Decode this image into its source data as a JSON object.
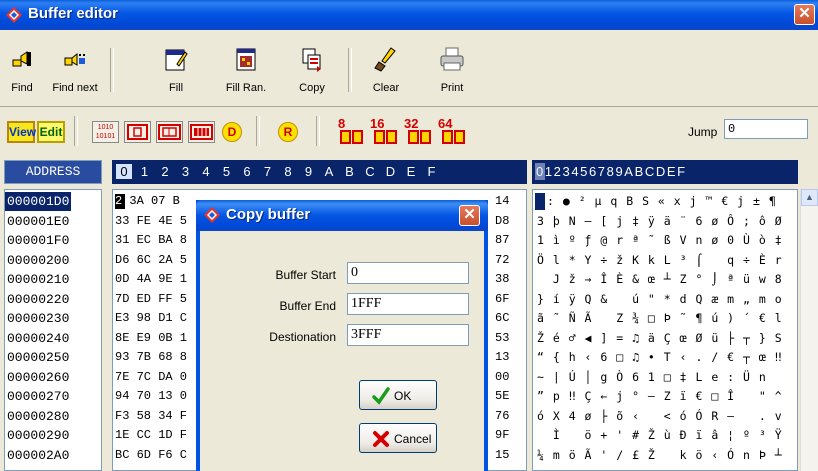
{
  "window": {
    "title": "Buffer editor",
    "close": "✕"
  },
  "toolbar": {
    "buttons": [
      {
        "label": "Find",
        "icon": "find-icon"
      },
      {
        "label": "Find next",
        "icon": "find-next-icon"
      },
      {
        "label": "Fill",
        "icon": "fill-icon"
      },
      {
        "label": "Fill Ran.",
        "icon": "fill-random-icon"
      },
      {
        "label": "Copy",
        "icon": "copy-icon"
      },
      {
        "label": "Clear",
        "icon": "clear-icon"
      },
      {
        "label": "Print",
        "icon": "printer-icon"
      }
    ]
  },
  "toolbar2": {
    "view_label": "View",
    "edit_label": "Edit",
    "mode_binary": "1010\n10101",
    "d_label": "D",
    "r_label": "R",
    "bits": [
      "8",
      "16",
      "32",
      "64"
    ],
    "jump_label": "Jump",
    "jump_value": "0"
  },
  "grid": {
    "address_header": "ADDRESS",
    "hex_columns": [
      "0",
      "1",
      "2",
      "3",
      "4",
      "5",
      "6",
      "7",
      "8",
      "9",
      "A",
      "B",
      "C",
      "D",
      "E",
      "F"
    ],
    "ascii_header": "0123456789ABCDEF",
    "rows": [
      {
        "address": "000001D0",
        "hex_left": "2 3A 07 B",
        "hex_right": "14",
        "ascii": ": ● ² µ q B S « x j ™ € j ± ¶"
      },
      {
        "address": "000001E0",
        "hex_left": "33 FE 4E 5",
        "hex_right": "D8",
        "ascii": "3 þ N – [ j ‡ ÿ ä ¨ 6 ø Ô ; ô Ø"
      },
      {
        "address": "000001F0",
        "hex_left": "31 EC BA 8",
        "hex_right": "87",
        "ascii": "1 ì º ƒ @ r ª ˜ ß V n ø 0 Ù ò ‡"
      },
      {
        "address": "00000200",
        "hex_left": "D6 6C 2A 5",
        "hex_right": "72",
        "ascii": "Ö l * Y ÷ ž K k L ³ ⌠   q ÷ È r"
      },
      {
        "address": "00000210",
        "hex_left": "0D 4A 9E 1",
        "hex_right": "38",
        "ascii": "  J ž → Î È & œ ┴ Z ° ⌡ ª ü w 8"
      },
      {
        "address": "00000220",
        "hex_left": "7D ED FF 5",
        "hex_right": "6F",
        "ascii": "} í ÿ Q &   ú \" * d Q æ m „ m o"
      },
      {
        "address": "00000230",
        "hex_left": "E3 98 D1 C",
        "hex_right": "6C",
        "ascii": "ã ˜ Ñ Ã   Z ¾ □ Þ ˜ ¶ ú ) ´ € l"
      },
      {
        "address": "00000240",
        "hex_left": "8E E9 0B 1",
        "hex_right": "53",
        "ascii": "Ž é ♂ ◀ ] = ♫ ä Ç œ Ø ü ├ ┬ } S"
      },
      {
        "address": "00000250",
        "hex_left": "93 7B 68 8",
        "hex_right": "13",
        "ascii": "“ { h ‹ 6 □ ♫ • T ‹ . / € ┬ œ ‼"
      },
      {
        "address": "00000260",
        "hex_left": "7E 7C DA 0",
        "hex_right": "00",
        "ascii": "~ | Ú │ g Ò 6 1 □ ‡ L e : Ü n  "
      },
      {
        "address": "00000270",
        "hex_left": "94 70 13 0",
        "hex_right": "5E",
        "ascii": "” p ‼ Ç ← j ° – Z ï € □ Î   \" ^"
      },
      {
        "address": "00000280",
        "hex_left": "F3 58 34 F",
        "hex_right": "76",
        "ascii": "ó X 4 ø ├ õ ‹   < ó Ó R –   . v"
      },
      {
        "address": "00000290",
        "hex_left": "1E CC 1D F",
        "hex_right": "9F",
        "ascii": "  Ì   ö + ' # Ž ù Ð ï â ¦ º ³ Ÿ"
      },
      {
        "address": "000002A0",
        "hex_left": "BC 6D F6 C",
        "hex_right": "15",
        "ascii": "¼ m ö Ã ' ∕ £ Ž   k ö ‹ Ó n Þ ┴"
      }
    ]
  },
  "dialog": {
    "title": "Copy buffer",
    "close": "✕",
    "fields": [
      {
        "label": "Buffer Start",
        "value": "0"
      },
      {
        "label": "Buffer End",
        "value": "1FFF"
      },
      {
        "label": "Destionation",
        "value": "3FFF"
      }
    ],
    "ok_label": "OK",
    "cancel_label": "Cancel"
  },
  "colors": {
    "titlebar": "#0054e3",
    "selection": "#0a246a",
    "chrome": "#ece9d8",
    "accent_red": "#d40000",
    "accent_yellow": "#f8e71c"
  }
}
